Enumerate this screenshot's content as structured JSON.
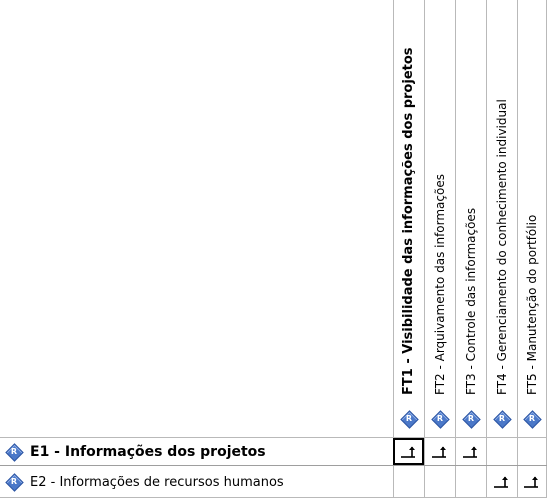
{
  "columns": [
    {
      "label": "FT1 - Visibilidade das informações dos projetos",
      "bold": true,
      "icon": "requirement-icon"
    },
    {
      "label": "FT2 - Arquivamento das informações",
      "bold": false,
      "icon": "requirement-icon"
    },
    {
      "label": "FT3 - Controle das informações",
      "bold": false,
      "icon": "requirement-icon"
    },
    {
      "label": "FT4 - Gerenciamento do conhecimento individual",
      "bold": false,
      "icon": "requirement-icon"
    },
    {
      "label": "FT5 - Manutenção do portfólio",
      "bold": false,
      "icon": "requirement-icon"
    }
  ],
  "rows": [
    {
      "label": "E1 - Informações dos projetos",
      "bold": true,
      "icon": "requirement-icon",
      "dependencies": [
        true,
        true,
        true,
        false,
        false
      ]
    },
    {
      "label": "E2 - Informações de recursos humanos",
      "bold": false,
      "icon": "requirement-icon",
      "dependencies": [
        false,
        false,
        false,
        true,
        true
      ]
    }
  ],
  "icon_letter": "R",
  "selected_cell": {
    "row": 0,
    "column": 0
  }
}
